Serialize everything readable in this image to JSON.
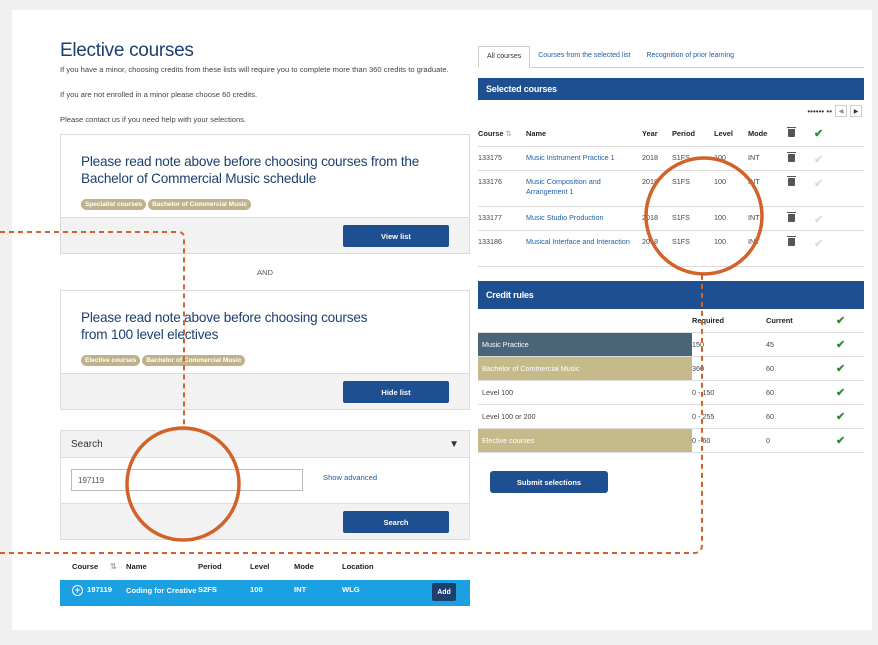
{
  "title": "Elective courses",
  "intro": [
    "If you have a minor, choosing credits from these lists will require you to complete more than 360 credits to graduate.",
    "If you are not enrolled in a minor please choose 60 credits.",
    "Please contact us if you need help with your selections."
  ],
  "card1": {
    "title": "Please read note above before choosing courses from the Bachelor of Commercial Music schedule",
    "tags": [
      "Specialist courses",
      "Bachelor of Commercial Music"
    ],
    "button": "View list"
  },
  "and_label": "AND",
  "card2": {
    "title": "Please read note above before choosing courses from 100 level electives",
    "tags": [
      "Elective courses",
      "Bachelor of Commercial Music"
    ],
    "button": "Hide list"
  },
  "search": {
    "heading": "Search",
    "value": "197119",
    "show_advanced": "Show advanced",
    "button": "Search"
  },
  "results": {
    "headers": [
      "Course",
      "Name",
      "Period",
      "Level",
      "Mode",
      "Location"
    ],
    "rows": [
      {
        "course": "197119",
        "name": "Coding for Creative",
        "period": "S2FS",
        "level": "100",
        "mode": "INT",
        "location": "WLG",
        "action": "Add"
      }
    ]
  },
  "tabs": [
    "All courses",
    "Courses from the selected list",
    "Recognition of prior learning"
  ],
  "selected": {
    "heading": "Selected courses",
    "pager": "•••••• ••",
    "headers": [
      "Course",
      "Name",
      "Year",
      "Period",
      "Level",
      "Mode"
    ],
    "rows": [
      {
        "course": "133175",
        "name": "Music Instrument Practice 1",
        "year": "2018",
        "period": "S1FS",
        "level": "100",
        "mode": "INT"
      },
      {
        "course": "133176",
        "name": "Music Composition and Arrangement 1",
        "year": "2018",
        "period": "S1FS",
        "level": "100",
        "mode": "INT"
      },
      {
        "course": "133177",
        "name": "Music Studio Production",
        "year": "2018",
        "period": "S1FS",
        "level": "100",
        "mode": "INT"
      },
      {
        "course": "133186",
        "name": "Musical Interface and Interaction",
        "year": "2018",
        "period": "S1FS",
        "level": "100",
        "mode": "INT"
      }
    ]
  },
  "credit": {
    "heading": "Credit rules",
    "headers": [
      "",
      "Required",
      "Current"
    ],
    "rows": [
      {
        "label": "Music Practice",
        "required": "150",
        "current": "45",
        "style": "dark"
      },
      {
        "label": "Bachelor of Commercial Music",
        "required": "360",
        "current": "60",
        "style": "tan"
      },
      {
        "label": "Level 100",
        "required": "0 - 150",
        "current": "60",
        "style": "plain"
      },
      {
        "label": "Level 100 or 200",
        "required": "0 - 255",
        "current": "60",
        "style": "plain"
      },
      {
        "label": "Elective courses",
        "required": "0 - 60",
        "current": "0",
        "style": "tan"
      }
    ],
    "submit": "Submit selections"
  },
  "colors": {
    "navy": "#1d4f91",
    "annotation": "#d2622a",
    "highlight": "#1ba0e2"
  }
}
